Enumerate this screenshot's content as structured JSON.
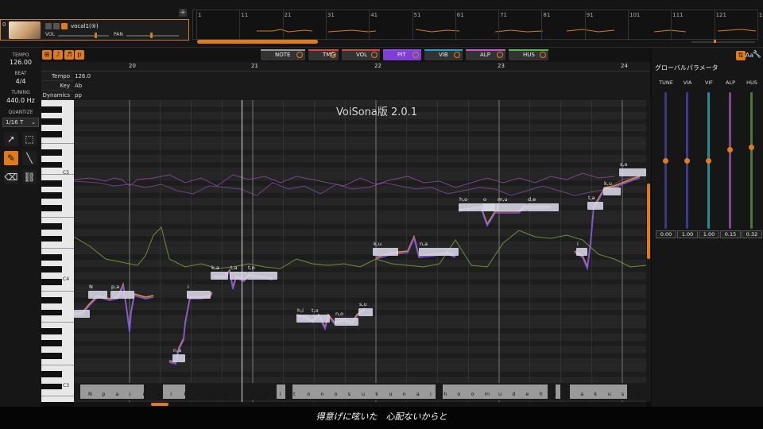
{
  "track": {
    "number": "0",
    "name": "vocal1(⑤)",
    "vol_label": "VOL",
    "pan_label": "PAN",
    "add_label": "+"
  },
  "overview": {
    "bar_numbers": [
      "1",
      "11",
      "21",
      "31",
      "41",
      "51",
      "61",
      "71",
      "81",
      "91",
      "101",
      "111",
      "121",
      "13"
    ]
  },
  "left_panel": {
    "tempo_label": "TEMPO",
    "tempo_value": "126.00",
    "beat_label": "BEAT",
    "beat_value": "4/4",
    "tuning_label": "TUNING",
    "tuning_value": "440.0 Hz",
    "quantize_label": "QUANTIZE",
    "quantize_value": "1/16 T"
  },
  "modes": [
    {
      "label": "NOTE",
      "color": "#9a9a9a"
    },
    {
      "label": "TMG",
      "color": "#c94a4a"
    },
    {
      "label": "VOL",
      "color": "#c94a4a"
    },
    {
      "label": "PIT",
      "color": "#8a4fe0",
      "active": true
    },
    {
      "label": "VIB",
      "color": "#2aa0c0"
    },
    {
      "label": "ALP",
      "color": "#c060c0"
    },
    {
      "label": "HUS",
      "color": "#60b060"
    }
  ],
  "ruler": {
    "bars": [
      "20",
      "21",
      "22",
      "23",
      "24"
    ]
  },
  "param_rows": [
    {
      "label": "Tempo",
      "value": "126.0"
    },
    {
      "label": "Key",
      "value": "Ab"
    },
    {
      "label": "Dynamics",
      "value": "pp"
    }
  ],
  "keyboard": {
    "labels": [
      "C5",
      "C4",
      "C3"
    ]
  },
  "watermark": "VoiSona版 2.0.1",
  "notes": [
    {
      "lyric": "",
      "below": ""
    },
    {
      "lyric": "N",
      "below": ""
    },
    {
      "lyric": "p,a",
      "below": ""
    },
    {
      "lyric": "n,a",
      "below": ""
    },
    {
      "lyric": "i",
      "below": ""
    },
    {
      "lyric": "k,a",
      "below": ""
    },
    {
      "lyric": "t,a",
      "below": ""
    },
    {
      "lyric": "t,o",
      "below": ""
    },
    {
      "lyric": "h,i",
      "below": ""
    },
    {
      "lyric": "t,o",
      "below": ""
    },
    {
      "lyric": "n,o",
      "below": ""
    },
    {
      "lyric": "s,u",
      "below": ""
    },
    {
      "lyric": "k,u",
      "below": ""
    },
    {
      "lyric": "n,a",
      "below": ""
    },
    {
      "lyric": "h,o",
      "below": ""
    },
    {
      "lyric": "o",
      "below": ""
    },
    {
      "lyric": "m,u",
      "below": ""
    },
    {
      "lyric": "d,e",
      "below": ""
    },
    {
      "lyric": "t,a",
      "below": ""
    },
    {
      "lyric": "i",
      "below": ""
    },
    {
      "lyric": "k,u",
      "below": ""
    },
    {
      "lyric": "s,o",
      "below": ""
    }
  ],
  "phoneme_lane": [
    "N",
    "p",
    "a",
    "i",
    "n",
    "a",
    "i",
    "k",
    "a",
    "t",
    "a",
    "t",
    "o",
    "h",
    "i",
    "t",
    "o",
    "n",
    "o",
    "s",
    "u",
    "k",
    "u",
    "n",
    "a",
    "i",
    "h",
    "o",
    "o",
    "m",
    "u",
    "d",
    "e",
    "h",
    "e",
    "t",
    "a",
    "k",
    "u",
    "s",
    "o"
  ],
  "global_params": {
    "title": "グローバルパラメータ",
    "params": [
      {
        "name": "TUNE",
        "value": "0.00",
        "level": 0.5,
        "color": "#3a3a7a"
      },
      {
        "name": "VIA",
        "value": "1.00",
        "level": 0.5,
        "color": "#3a3a9a"
      },
      {
        "name": "VIF",
        "value": "1.00",
        "level": 0.5,
        "color": "#2a8a9a"
      },
      {
        "name": "ALP",
        "value": "0.15",
        "level": 0.58,
        "color": "#7a4a8a"
      },
      {
        "name": "HUS",
        "value": "0.32",
        "level": 0.6,
        "color": "#4a7a3a"
      }
    ]
  },
  "subtitle": "得意げに呟いた　心配ないからと"
}
